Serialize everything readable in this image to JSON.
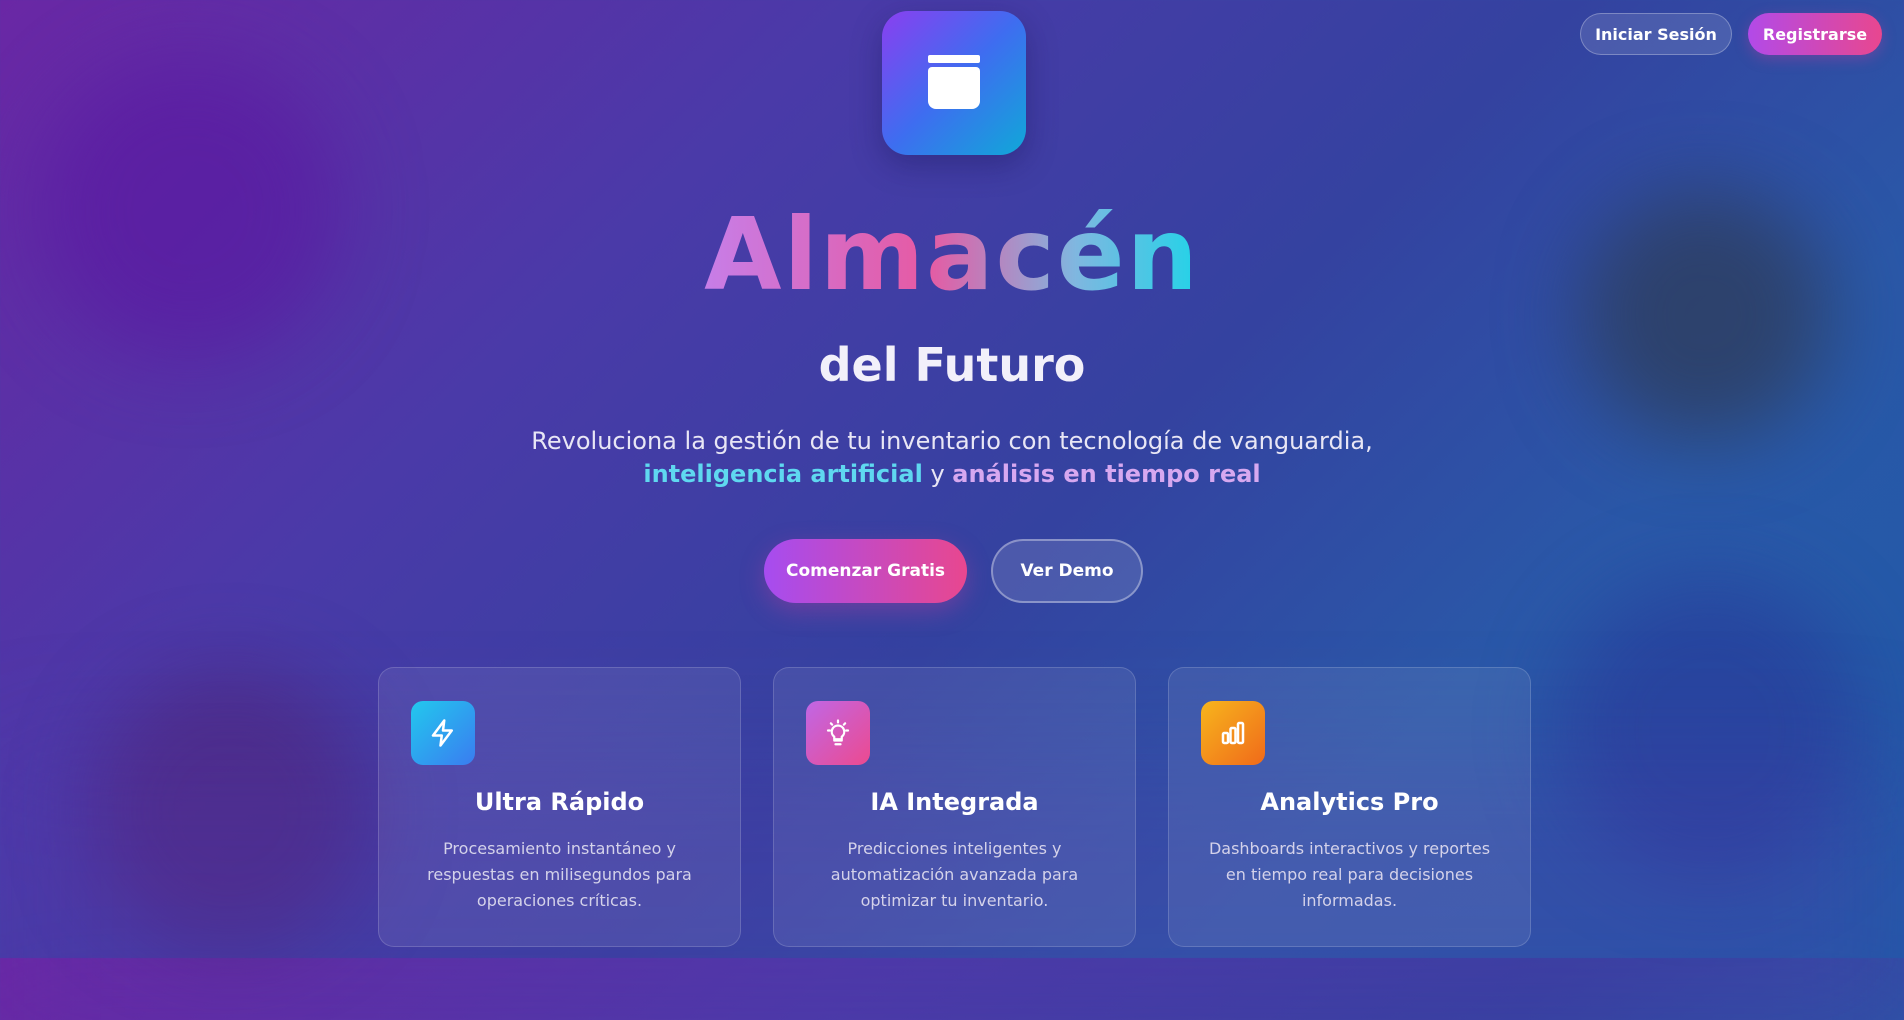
{
  "auth": {
    "login_label": "Iniciar Sesión",
    "register_label": "Registrarse"
  },
  "hero": {
    "logo_icon": "archive-box-icon",
    "title": "Almacén",
    "subtitle": "del Futuro",
    "description_line1": "Revoluciona la gestión de tu inventario con tecnología de vanguardia,",
    "description_highlight1": "inteligencia artificial",
    "description_connector": "y",
    "description_highlight2": "análisis en tiempo real"
  },
  "cta": {
    "start_label": "Comenzar Gratis",
    "demo_label": "Ver Demo"
  },
  "features": [
    {
      "icon": "lightning-icon",
      "title": "Ultra Rápido",
      "text": "Procesamiento instantáneo y respuestas en milisegundos para operaciones críticas."
    },
    {
      "icon": "lightbulb-icon",
      "title": "IA Integrada",
      "text": "Predicciones inteligentes y automatización avanzada para optimizar tu inventario."
    },
    {
      "icon": "bar-chart-icon",
      "title": "Analytics Pro",
      "text": "Dashboards interactivos y reportes en tiempo real para decisiones informadas."
    }
  ],
  "colors": {
    "brand_purple": "#a64cf0",
    "brand_pink": "#e8478f",
    "accent_cyan": "#5fd8f0",
    "accent_lilac": "#d7a8f0"
  }
}
